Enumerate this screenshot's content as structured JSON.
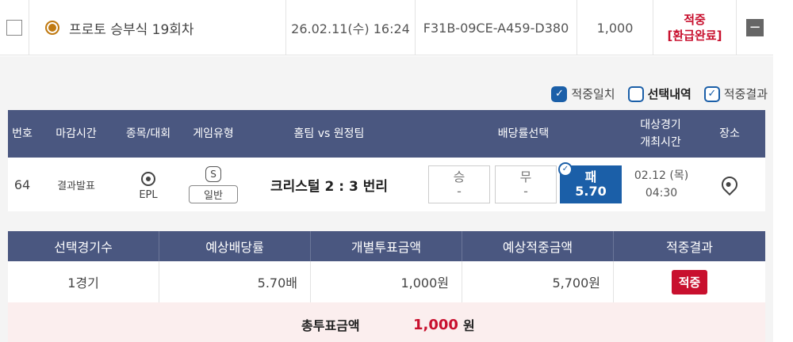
{
  "slip": {
    "title": "프로토 승부식 19회차",
    "date": "26.02.11(수) 16:24",
    "code": "F31B-09CE-A459-D380",
    "amount": "1,000",
    "status_line1": "적중",
    "status_line2": "[환급완료]",
    "toggle_label": "−"
  },
  "legend": {
    "items": [
      {
        "label": "적중일치",
        "icon": "check-filled-icon"
      },
      {
        "label": "선택내역",
        "icon": "empty-box-icon"
      },
      {
        "label": "적중결과",
        "icon": "check-outline-icon"
      }
    ]
  },
  "game_table": {
    "headers": {
      "no": "번호",
      "deadline": "마감시간",
      "league": "종목/대회",
      "game_type": "게임유형",
      "teams": "홈팀 vs 원정팀",
      "odds_select": "배당률선택",
      "event_time_1": "대상경기",
      "event_time_2": "개최시간",
      "venue": "장소"
    },
    "row": {
      "no": "64",
      "deadline": "결과발표",
      "league": "EPL",
      "game_type_badge": "S",
      "game_type": "일반",
      "match": "크리스털 2 : 3 번리",
      "odds": [
        {
          "label": "승",
          "value": "-"
        },
        {
          "label": "무",
          "value": "-"
        },
        {
          "label": "패",
          "value": "5.70"
        }
      ],
      "event_date": "02.12 (목)",
      "event_time": "04:30"
    }
  },
  "summary_table": {
    "headers": {
      "games": "선택경기수",
      "expected_odds": "예상배당률",
      "bet_amount": "개별투표금액",
      "expected_win": "예상적중금액",
      "result": "적중결과"
    },
    "row": {
      "games": "1경기",
      "expected_odds": "5.70배",
      "bet_amount": "1,000원",
      "expected_win": "5,700원",
      "result": "적중"
    }
  },
  "total": {
    "label": "총투표금액",
    "value": "1,000",
    "unit": "원"
  },
  "colors": {
    "accent": "#1b5fa8",
    "header": "#4a5780",
    "hit": "#c8102e"
  }
}
